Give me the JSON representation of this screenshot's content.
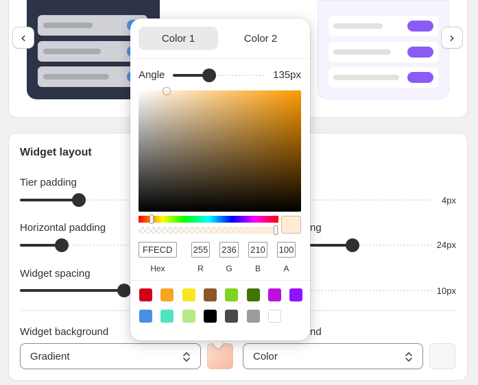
{
  "colors": {
    "dark_preview_bg": "#2d3447",
    "dark_preview_row": "#cfd1d6",
    "dark_toggle": "#4a90e2",
    "light_preview_bg": "#f6f3ff",
    "light_toggle": "#8a5cf5",
    "accent_dark": "#303030",
    "selected_color": "#FFECD2",
    "gradient_swatch_from": "#fde1d3",
    "gradient_swatch_to": "#f6b9a0"
  },
  "nav": {
    "prev_icon": "chevron-left-icon",
    "prev_glyph": "‹",
    "next_icon": "chevron-right-icon",
    "next_glyph": "›"
  },
  "layout_section": {
    "title": "Widget layout",
    "tier_padding": {
      "label": "Tier padding",
      "value": "4px",
      "level": 0.0
    },
    "horizontal_padding": {
      "label": "Horizontal padding",
      "value_hidden_suffix": "ng",
      "value": "24px",
      "level": 0.2
    },
    "widget_spacing": {
      "label": "Widget spacing",
      "value": "10px",
      "level": 0.1
    },
    "widget_background": {
      "label": "Widget background",
      "select_value": "Gradient"
    },
    "right_background": {
      "label_suffix": "nd",
      "select_value": "Color"
    }
  },
  "color_picker": {
    "tabs": [
      "Color 1",
      "Color 2"
    ],
    "active_tab": 0,
    "angle": {
      "label": "Angle",
      "value": "135px",
      "level": 0.375
    },
    "hex": {
      "value": "FFECD",
      "label": "Hex"
    },
    "r": {
      "value": "255",
      "label": "R"
    },
    "g": {
      "value": "236",
      "label": "G"
    },
    "b": {
      "value": "210",
      "label": "B"
    },
    "a": {
      "value": "100",
      "label": "A"
    },
    "hue_level": 0.09,
    "alpha_level": 1.0,
    "presets": [
      "#d0021b",
      "#f5a623",
      "#f8e71c",
      "#8b572a",
      "#7ed321",
      "#417505",
      "#bd10e0",
      "#9013fe",
      "#4a90e2",
      "#50e3c2",
      "#b8e986",
      "#000000",
      "#4a4a4a",
      "#9b9b9b",
      "#ffffff"
    ]
  }
}
